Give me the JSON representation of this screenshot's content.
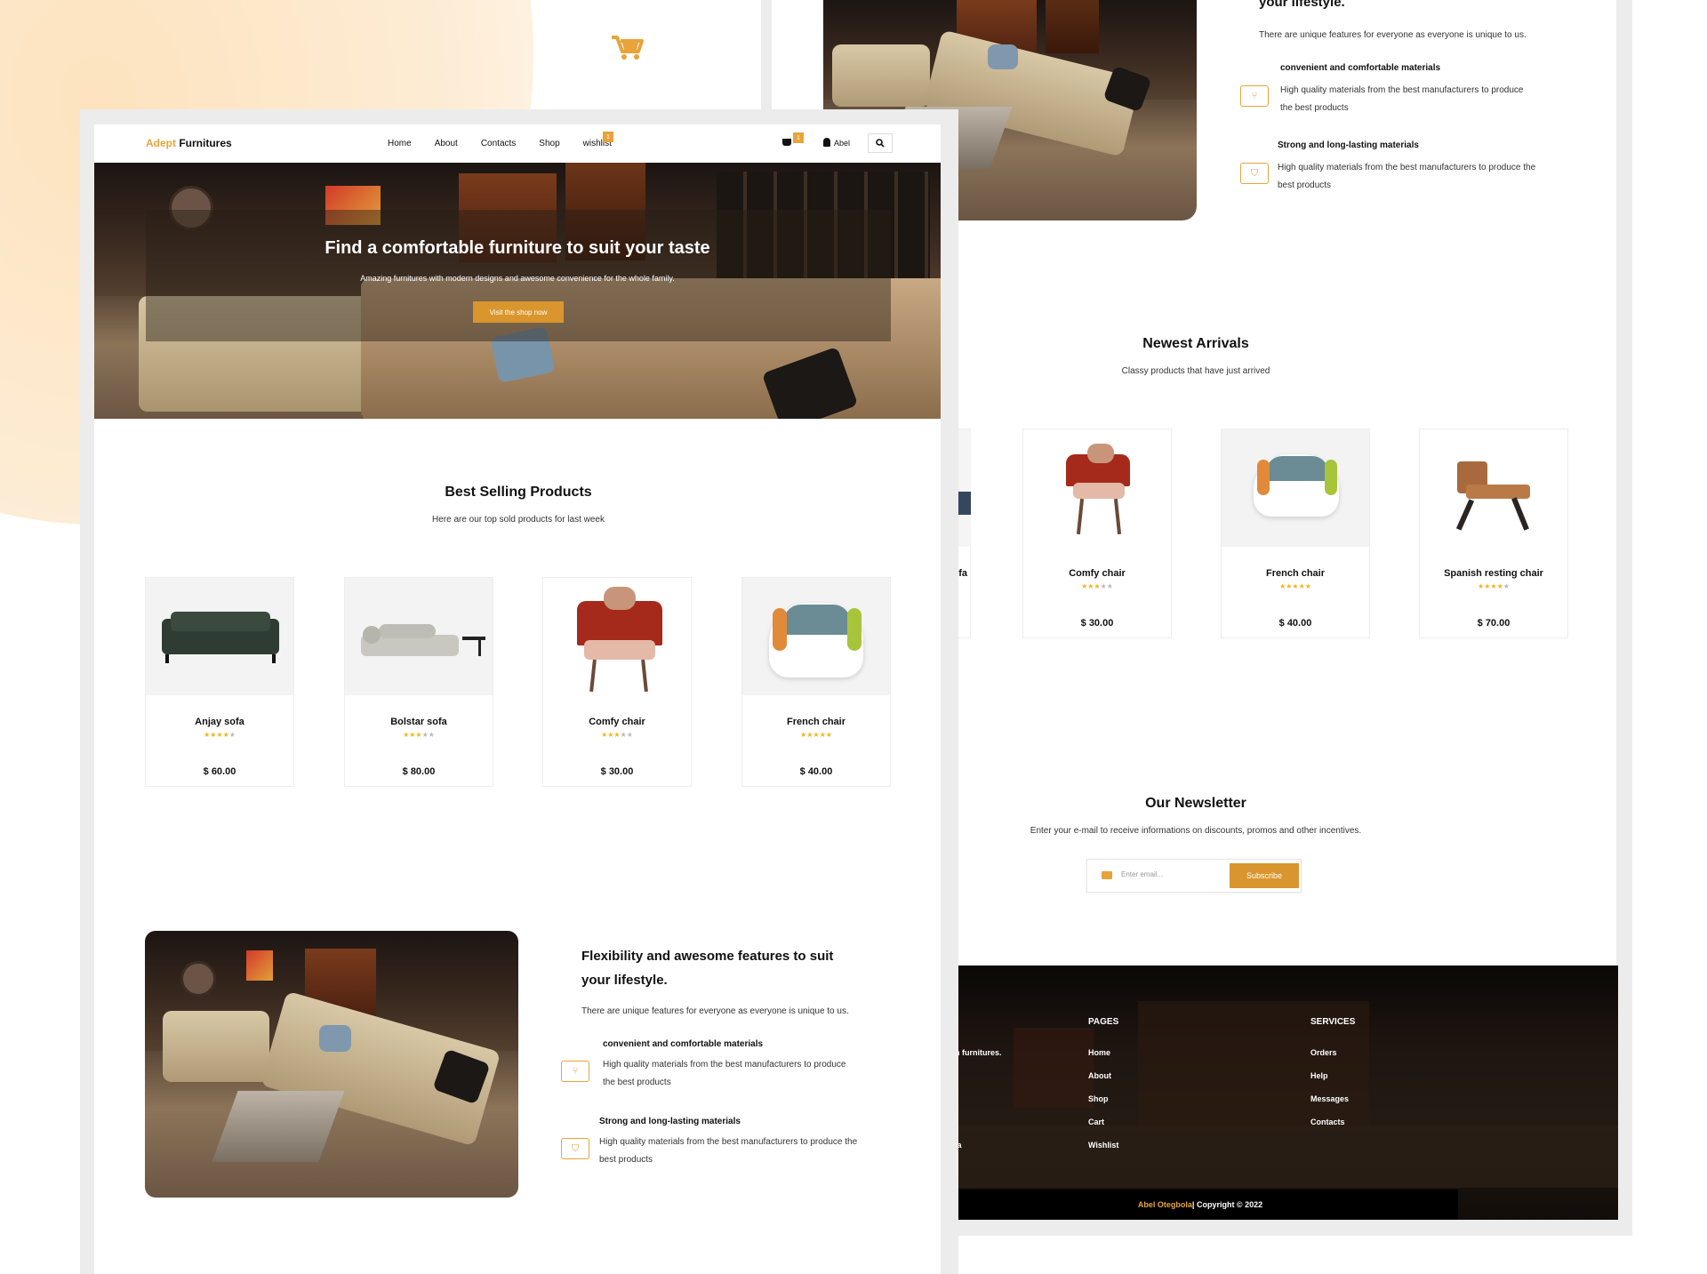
{
  "brand": {
    "first": "Adept",
    "second": " Furnitures"
  },
  "nav": {
    "items": [
      "Home",
      "About",
      "Contacts",
      "Shop",
      "wishlist"
    ],
    "wishlist_badge": "1",
    "cart_badge": "1",
    "user": "Abel"
  },
  "hero": {
    "title": "Find a comfortable furniture to suit your taste",
    "subtitle": "Amazing furnitures with modern designs and awesome convenience for the whole family.",
    "cta": "Visit the shop now"
  },
  "best_selling": {
    "title": "Best Selling Products",
    "subtitle": "Here are our top sold products for last week",
    "products": [
      {
        "name": "Anjay sofa",
        "rating": 4,
        "price": "$ 60.00"
      },
      {
        "name": "Bolstar sofa",
        "rating": 3,
        "price": "$ 80.00"
      },
      {
        "name": "Comfy chair",
        "rating": 3,
        "price": "$ 30.00"
      },
      {
        "name": "French chair",
        "rating": 5,
        "price": "$ 40.00"
      }
    ]
  },
  "features": {
    "title_line1": "Flexibility and awesome features to suit",
    "title_line2": "your lifestyle.",
    "right_title_tail": "your lifestyle.",
    "intro": "There are unique features for everyone as everyone is unique to us.",
    "items": [
      {
        "title": "convenient and comfortable materials",
        "text_line1": "High quality materials from the best manufacturers to produce",
        "text_line2": "the best products",
        "icon": "chair-icon"
      },
      {
        "title": "Strong and long-lasting materials",
        "text_line1": "High quality materials from the best manufacturers to produce the",
        "text_line2": "best products",
        "icon": "shield-icon"
      }
    ]
  },
  "newest": {
    "title": "Newest Arrivals",
    "subtitle": "Classy products that have just arrived",
    "partial_label": "fa",
    "products": [
      {
        "name": "Comfy chair",
        "rating": 3,
        "price": "$ 30.00"
      },
      {
        "name": "French chair",
        "rating": 5,
        "price": "$ 40.00"
      },
      {
        "name": "Spanish resting chair",
        "rating": 4,
        "price": "$ 70.00"
      }
    ]
  },
  "newsletter": {
    "title": "Our Newsletter",
    "subtitle": "Enter your e-mail to receive informations on discounts, promos and other incentives.",
    "placeholder": "Enter email...",
    "button": "Subscribe"
  },
  "footer": {
    "partial_text": "dern furnitures.",
    "partial_text2": "geria",
    "pages_heading": "PAGES",
    "pages": [
      "Home",
      "About",
      "Shop",
      "Cart",
      "Wishlist"
    ],
    "services_heading": "SERVICES",
    "services": [
      "Orders",
      "Help",
      "Messages",
      "Contacts"
    ],
    "copyright_name": "Abel Otegbola",
    "copyright_rest": " | Copyright © 2022"
  },
  "colors": {
    "accent": "#e8a33a",
    "button": "#d9962e",
    "star": "#f1b51c"
  }
}
